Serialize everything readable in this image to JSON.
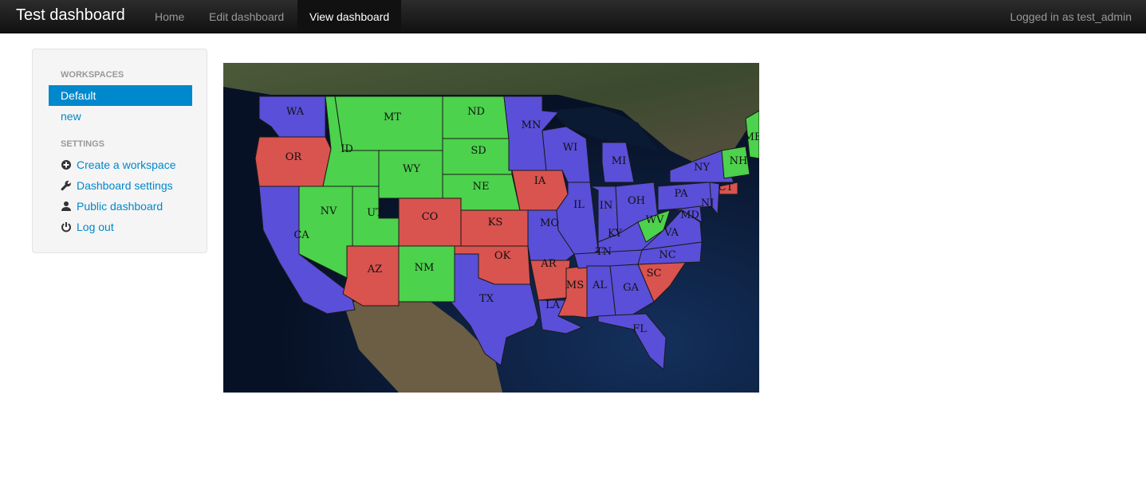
{
  "navbar": {
    "brand": "Test dashboard",
    "links": [
      "Home",
      "Edit dashboard",
      "View dashboard"
    ],
    "active": "View dashboard",
    "user_text": "Logged in as test_admin"
  },
  "sidebar": {
    "workspaces_header": "WORKSPACES",
    "workspaces": [
      "Default",
      "new"
    ],
    "active_workspace": "Default",
    "settings_header": "SETTINGS",
    "settings": [
      {
        "label": "Create a workspace",
        "icon": "plus-circle-icon"
      },
      {
        "label": "Dashboard settings",
        "icon": "wrench-icon"
      },
      {
        "label": "Public dashboard",
        "icon": "user-icon"
      },
      {
        "label": "Log out",
        "icon": "power-icon"
      }
    ]
  },
  "map": {
    "colors": {
      "blue": "#5a4fd8",
      "green": "#4cd24c",
      "red": "#d9534f"
    },
    "states": [
      {
        "code": "WA",
        "c": "blue"
      },
      {
        "code": "OR",
        "c": "red"
      },
      {
        "code": "CA",
        "c": "blue"
      },
      {
        "code": "ID",
        "c": "green"
      },
      {
        "code": "MT",
        "c": "green"
      },
      {
        "code": "NV",
        "c": "green"
      },
      {
        "code": "UT",
        "c": "green"
      },
      {
        "code": "WY",
        "c": "green"
      },
      {
        "code": "AZ",
        "c": "red"
      },
      {
        "code": "NM",
        "c": "green"
      },
      {
        "code": "CO",
        "c": "red"
      },
      {
        "code": "ND",
        "c": "green"
      },
      {
        "code": "SD",
        "c": "green"
      },
      {
        "code": "NE",
        "c": "green"
      },
      {
        "code": "KS",
        "c": "red"
      },
      {
        "code": "OK",
        "c": "red"
      },
      {
        "code": "TX",
        "c": "blue"
      },
      {
        "code": "MN",
        "c": "blue"
      },
      {
        "code": "IA",
        "c": "red"
      },
      {
        "code": "MO",
        "c": "blue"
      },
      {
        "code": "AR",
        "c": "red"
      },
      {
        "code": "LA",
        "c": "blue"
      },
      {
        "code": "WI",
        "c": "blue"
      },
      {
        "code": "IL",
        "c": "blue"
      },
      {
        "code": "MS",
        "c": "red"
      },
      {
        "code": "MI",
        "c": "blue"
      },
      {
        "code": "IN",
        "c": "blue"
      },
      {
        "code": "KY",
        "c": "blue"
      },
      {
        "code": "TN",
        "c": "blue"
      },
      {
        "code": "AL",
        "c": "blue"
      },
      {
        "code": "OH",
        "c": "blue"
      },
      {
        "code": "GA",
        "c": "blue"
      },
      {
        "code": "FL",
        "c": "blue"
      },
      {
        "code": "SC",
        "c": "red"
      },
      {
        "code": "NC",
        "c": "blue"
      },
      {
        "code": "WV",
        "c": "green"
      },
      {
        "code": "VA",
        "c": "blue"
      },
      {
        "code": "PA",
        "c": "blue"
      },
      {
        "code": "NY",
        "c": "blue"
      },
      {
        "code": "MD",
        "c": "blue"
      },
      {
        "code": "NJ",
        "c": "blue"
      },
      {
        "code": "CT",
        "c": "red"
      },
      {
        "code": "NH",
        "c": "green"
      },
      {
        "code": "ME",
        "c": "green"
      }
    ]
  }
}
